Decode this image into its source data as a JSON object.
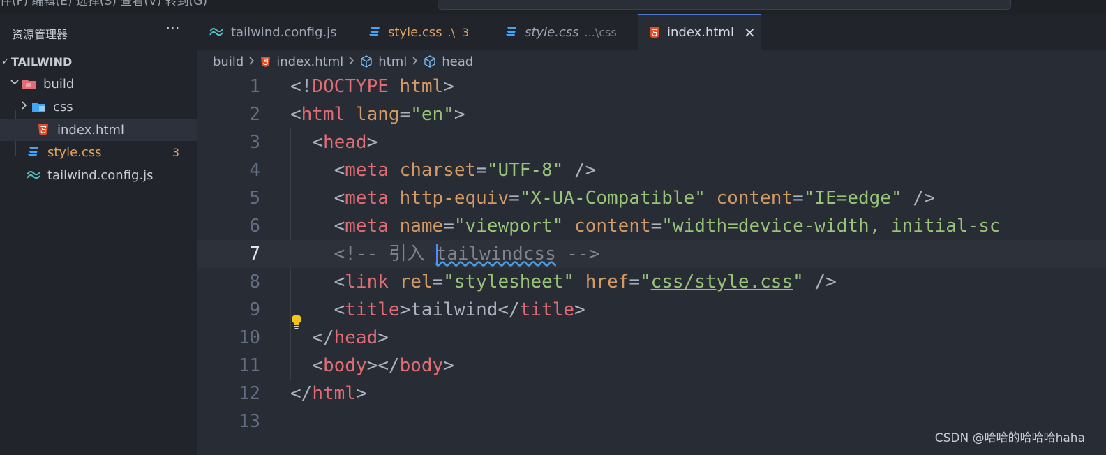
{
  "menubar": {
    "text": "件(F)  编辑(E)  选择(S)  查看(V)  转到(G)"
  },
  "sidebar": {
    "title": "资源管理器",
    "more": "···",
    "root": "TAILWIND",
    "items": [
      {
        "label": "build"
      },
      {
        "label": "css"
      },
      {
        "label": "index.html"
      },
      {
        "label": "style.css",
        "badge": "3"
      },
      {
        "label": "tailwind.config.js"
      }
    ]
  },
  "tabs": [
    {
      "label": "tailwind.config.js"
    },
    {
      "label": "style.css",
      "extra": ".\\",
      "count": "3"
    },
    {
      "label": "style.css",
      "extra": "...\\css"
    },
    {
      "label": "index.html",
      "close": "✕"
    }
  ],
  "breadcrumb": {
    "parts": [
      "build",
      "index.html",
      "html",
      "head"
    ]
  },
  "editor": {
    "line_numbers": [
      "1",
      "2",
      "3",
      "4",
      "5",
      "6",
      "7",
      "8",
      "9",
      "10",
      "11",
      "12",
      "13"
    ],
    "current_line": 7,
    "code": {
      "l1": {
        "open": "<!",
        "doctype": "DOCTYPE",
        "space": " ",
        "html": "html",
        "close": ">"
      },
      "l2": {
        "open": "<",
        "tag": "html",
        "sp": " ",
        "attr": "lang",
        "eq": "=",
        "val": "\"en\"",
        "close": ">"
      },
      "l3": {
        "indent": "  ",
        "open": "<",
        "tag": "head",
        "close": ">"
      },
      "l4": {
        "indent": "    ",
        "open": "<",
        "tag": "meta",
        "sp": " ",
        "attr": "charset",
        "eq": "=",
        "val": "\"UTF-8\"",
        "close": " />"
      },
      "l5": {
        "indent": "    ",
        "open": "<",
        "tag": "meta",
        "sp": " ",
        "attr1": "http-equiv",
        "eq1": "=",
        "val1": "\"X-UA-Compatible\"",
        "sp2": " ",
        "attr2": "content",
        "eq2": "=",
        "val2": "\"IE=edge\"",
        "close": " />"
      },
      "l6": {
        "indent": "    ",
        "open": "<",
        "tag": "meta",
        "sp": " ",
        "attr1": "name",
        "eq1": "=",
        "val1": "\"viewport\"",
        "sp2": " ",
        "attr2": "content",
        "eq2": "=",
        "val2": "\"width=device-width, initial-sc"
      },
      "l7": {
        "indent": "    ",
        "comment_start": "<!-- 引入 ",
        "comment_word": "tailwindcss",
        "comment_end": " -->"
      },
      "l8": {
        "indent": "    ",
        "open": "<",
        "tag": "link",
        "sp": " ",
        "attr1": "rel",
        "eq1": "=",
        "val1": "\"stylesheet\"",
        "sp2": " ",
        "attr2": "href",
        "eq2": "=",
        "q1": "\"",
        "url": "css/style.css",
        "q2": "\"",
        "close": " />"
      },
      "l9": {
        "indent": "    ",
        "open": "<",
        "tag": "title",
        "close1": ">",
        "text": "tailwind",
        "open2": "</",
        "tag2": "title",
        "close2": ">"
      },
      "l10": {
        "indent": "  ",
        "open": "</",
        "tag": "head",
        "close": ">"
      },
      "l11": {
        "indent": "  ",
        "open": "<",
        "tag": "body",
        "mid": "></",
        "tag2": "body",
        "close": ">"
      },
      "l12": {
        "open": "</",
        "tag": "html",
        "close": ">"
      }
    }
  },
  "watermark": "CSDN @哈哈的哈哈哈haha"
}
